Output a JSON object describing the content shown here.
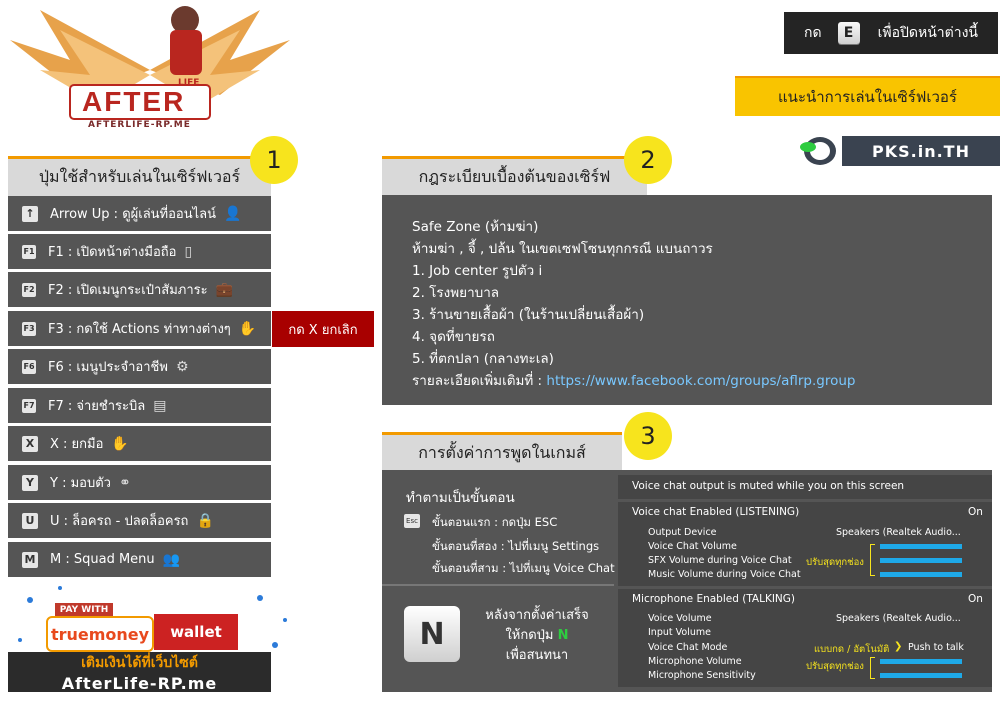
{
  "logo": {
    "text": "AFTER",
    "sub": "LIFE",
    "url": "AFTERLIFE-RP.ME"
  },
  "close_hint": {
    "prefix": "กด",
    "key": "E",
    "suffix": "เพื่อปิดหน้าต่างนี้"
  },
  "guide_banner": "แนะนำการเล่นในเซิร์ฟเวอร์",
  "pks": "PKS.in.TH",
  "section1": {
    "number": "1",
    "title": "ปุ่มใช้สำหรับเล่นในเซิร์ฟเวอร์",
    "items": [
      {
        "key": "↑",
        "label": "Arrow Up : ดูผู้เล่นที่ออนไลน์",
        "icon": "user-icon",
        "glyph": "👤"
      },
      {
        "key": "F1",
        "label": "F1 : เปิดหน้าต่างมือถือ",
        "icon": "phone-icon",
        "glyph": "▯"
      },
      {
        "key": "F2",
        "label": "F2 : เปิดเมนูกระเป๋าสัมภาระ",
        "icon": "briefcase-icon",
        "glyph": "💼"
      },
      {
        "key": "F3",
        "label": "F3 : กดใช้ Actions ท่าทางต่างๆ",
        "icon": "hand-icon",
        "glyph": "✋"
      },
      {
        "key": "F6",
        "label": "F6 : เมนูประจำอาชีพ",
        "icon": "job-icon",
        "glyph": "⚙"
      },
      {
        "key": "F7",
        "label": "F7 : จ่ายชำระบิล",
        "icon": "bill-icon",
        "glyph": "▤"
      },
      {
        "key": "X",
        "label": "X : ยกมือ",
        "icon": "raise-hands-icon",
        "glyph": "✋"
      },
      {
        "key": "Y",
        "label": "Y : มอบตัว",
        "icon": "handcuffs-icon",
        "glyph": "⚭"
      },
      {
        "key": "U",
        "label": "U : ล็อครถ - ปลดล็อครถ",
        "icon": "lock-icon",
        "glyph": "🔒"
      },
      {
        "key": "M",
        "label": "M : Squad Menu",
        "icon": "squad-icon",
        "glyph": "👥"
      }
    ],
    "cancel_label": "กด X ยกเลิก"
  },
  "section2": {
    "number": "2",
    "title": "กฎระเบียบเบื้องต้นของเซิร์ฟ",
    "lines": [
      "Safe Zone (ห้ามฆ่า)",
      "ห้ามฆ่า , จี้ , ปล้น ในเขตเซฟโซนทุกกรณี แบนถาวร",
      "1. Job center รูปตัว i",
      "2. โรงพยาบาล",
      "3. ร้านขายเสื้อผ้า (ในร้านเปลี่ยนเสื้อผ้า)",
      "4. จุดที่ขายรถ",
      "5. ที่ตกปลา (กลางทะเล)"
    ],
    "more_prefix": "รายละเอียดเพิ่มเติมที่ :",
    "more_link": "https://www.facebook.com/groups/aflrp.group"
  },
  "section3": {
    "number": "3",
    "title": "การตั้งค่าการพูดในเกมส์",
    "steps_title": "ทำตามเป็นขั้นตอน",
    "esc_key": "Esc",
    "steps": [
      "ขั้นตอนแรก : กดปุ่ม ESC",
      "ขั้นตอนที่สอง : ไปที่เมนู Settings",
      "ขั้นตอนที่สาม : ไปที่เมนู Voice Chat"
    ],
    "n_key": "N",
    "after1": "หลังจากตั้งค่าเสร็จ",
    "after2_prefix": "ให้กดปุ่ม",
    "after2_key": "N",
    "after3": "เพื่อสนทนา",
    "voice": {
      "muted_notice": "Voice chat output is muted while you on this screen",
      "listening_header": "Voice chat Enabled (LISTENING)",
      "listening_state": "On",
      "output_device_label": "Output Device",
      "output_device_value": "Speakers (Realtek Audio...",
      "voice_chat_volume": "Voice Chat Volume",
      "sfx_volume": "SFX Volume during Voice Chat",
      "music_volume": "Music Volume during Voice Chat",
      "adjust_note": "ปรับสุดทุกช่อง",
      "talking_header": "Microphone Enabled (TALKING)",
      "talking_state": "On",
      "voice_volume": "Voice Volume",
      "voice_volume_value": "Speakers (Realtek Audio...",
      "input_volume": "Input Volume",
      "chat_mode": "Voice Chat Mode",
      "chat_mode_note": "แบบกด / อัตโนมัติ",
      "chat_mode_value": "Push to talk",
      "mic_volume": "Microphone Volume",
      "mic_sensitivity": "Microphone Sensitivity"
    }
  },
  "payment": {
    "pay_with": "PAY WITH",
    "truemoney": "truemoney",
    "wallet": "wallet",
    "topup": "เติมเงินได้ที่เว็บไซต์",
    "site": "AfterLife-RP.me"
  }
}
